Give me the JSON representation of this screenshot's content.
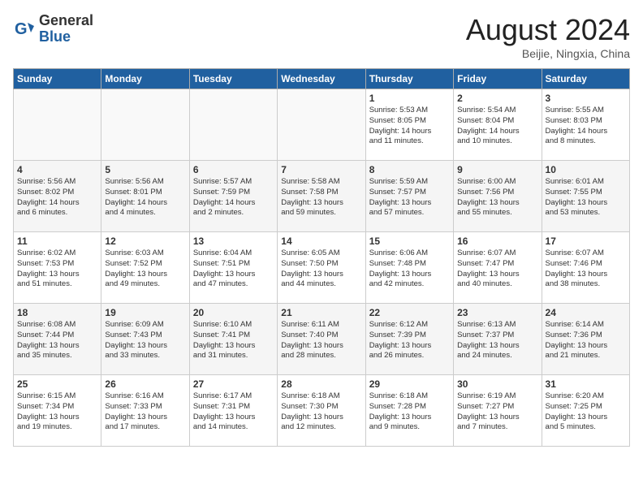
{
  "header": {
    "logo_general": "General",
    "logo_blue": "Blue",
    "month": "August 2024",
    "location": "Beijie, Ningxia, China"
  },
  "weekdays": [
    "Sunday",
    "Monday",
    "Tuesday",
    "Wednesday",
    "Thursday",
    "Friday",
    "Saturday"
  ],
  "weeks": [
    [
      {
        "day": "",
        "info": ""
      },
      {
        "day": "",
        "info": ""
      },
      {
        "day": "",
        "info": ""
      },
      {
        "day": "",
        "info": ""
      },
      {
        "day": "1",
        "info": "Sunrise: 5:53 AM\nSunset: 8:05 PM\nDaylight: 14 hours\nand 11 minutes."
      },
      {
        "day": "2",
        "info": "Sunrise: 5:54 AM\nSunset: 8:04 PM\nDaylight: 14 hours\nand 10 minutes."
      },
      {
        "day": "3",
        "info": "Sunrise: 5:55 AM\nSunset: 8:03 PM\nDaylight: 14 hours\nand 8 minutes."
      }
    ],
    [
      {
        "day": "4",
        "info": "Sunrise: 5:56 AM\nSunset: 8:02 PM\nDaylight: 14 hours\nand 6 minutes."
      },
      {
        "day": "5",
        "info": "Sunrise: 5:56 AM\nSunset: 8:01 PM\nDaylight: 14 hours\nand 4 minutes."
      },
      {
        "day": "6",
        "info": "Sunrise: 5:57 AM\nSunset: 7:59 PM\nDaylight: 14 hours\nand 2 minutes."
      },
      {
        "day": "7",
        "info": "Sunrise: 5:58 AM\nSunset: 7:58 PM\nDaylight: 13 hours\nand 59 minutes."
      },
      {
        "day": "8",
        "info": "Sunrise: 5:59 AM\nSunset: 7:57 PM\nDaylight: 13 hours\nand 57 minutes."
      },
      {
        "day": "9",
        "info": "Sunrise: 6:00 AM\nSunset: 7:56 PM\nDaylight: 13 hours\nand 55 minutes."
      },
      {
        "day": "10",
        "info": "Sunrise: 6:01 AM\nSunset: 7:55 PM\nDaylight: 13 hours\nand 53 minutes."
      }
    ],
    [
      {
        "day": "11",
        "info": "Sunrise: 6:02 AM\nSunset: 7:53 PM\nDaylight: 13 hours\nand 51 minutes."
      },
      {
        "day": "12",
        "info": "Sunrise: 6:03 AM\nSunset: 7:52 PM\nDaylight: 13 hours\nand 49 minutes."
      },
      {
        "day": "13",
        "info": "Sunrise: 6:04 AM\nSunset: 7:51 PM\nDaylight: 13 hours\nand 47 minutes."
      },
      {
        "day": "14",
        "info": "Sunrise: 6:05 AM\nSunset: 7:50 PM\nDaylight: 13 hours\nand 44 minutes."
      },
      {
        "day": "15",
        "info": "Sunrise: 6:06 AM\nSunset: 7:48 PM\nDaylight: 13 hours\nand 42 minutes."
      },
      {
        "day": "16",
        "info": "Sunrise: 6:07 AM\nSunset: 7:47 PM\nDaylight: 13 hours\nand 40 minutes."
      },
      {
        "day": "17",
        "info": "Sunrise: 6:07 AM\nSunset: 7:46 PM\nDaylight: 13 hours\nand 38 minutes."
      }
    ],
    [
      {
        "day": "18",
        "info": "Sunrise: 6:08 AM\nSunset: 7:44 PM\nDaylight: 13 hours\nand 35 minutes."
      },
      {
        "day": "19",
        "info": "Sunrise: 6:09 AM\nSunset: 7:43 PM\nDaylight: 13 hours\nand 33 minutes."
      },
      {
        "day": "20",
        "info": "Sunrise: 6:10 AM\nSunset: 7:41 PM\nDaylight: 13 hours\nand 31 minutes."
      },
      {
        "day": "21",
        "info": "Sunrise: 6:11 AM\nSunset: 7:40 PM\nDaylight: 13 hours\nand 28 minutes."
      },
      {
        "day": "22",
        "info": "Sunrise: 6:12 AM\nSunset: 7:39 PM\nDaylight: 13 hours\nand 26 minutes."
      },
      {
        "day": "23",
        "info": "Sunrise: 6:13 AM\nSunset: 7:37 PM\nDaylight: 13 hours\nand 24 minutes."
      },
      {
        "day": "24",
        "info": "Sunrise: 6:14 AM\nSunset: 7:36 PM\nDaylight: 13 hours\nand 21 minutes."
      }
    ],
    [
      {
        "day": "25",
        "info": "Sunrise: 6:15 AM\nSunset: 7:34 PM\nDaylight: 13 hours\nand 19 minutes."
      },
      {
        "day": "26",
        "info": "Sunrise: 6:16 AM\nSunset: 7:33 PM\nDaylight: 13 hours\nand 17 minutes."
      },
      {
        "day": "27",
        "info": "Sunrise: 6:17 AM\nSunset: 7:31 PM\nDaylight: 13 hours\nand 14 minutes."
      },
      {
        "day": "28",
        "info": "Sunrise: 6:18 AM\nSunset: 7:30 PM\nDaylight: 13 hours\nand 12 minutes."
      },
      {
        "day": "29",
        "info": "Sunrise: 6:18 AM\nSunset: 7:28 PM\nDaylight: 13 hours\nand 9 minutes."
      },
      {
        "day": "30",
        "info": "Sunrise: 6:19 AM\nSunset: 7:27 PM\nDaylight: 13 hours\nand 7 minutes."
      },
      {
        "day": "31",
        "info": "Sunrise: 6:20 AM\nSunset: 7:25 PM\nDaylight: 13 hours\nand 5 minutes."
      }
    ]
  ]
}
